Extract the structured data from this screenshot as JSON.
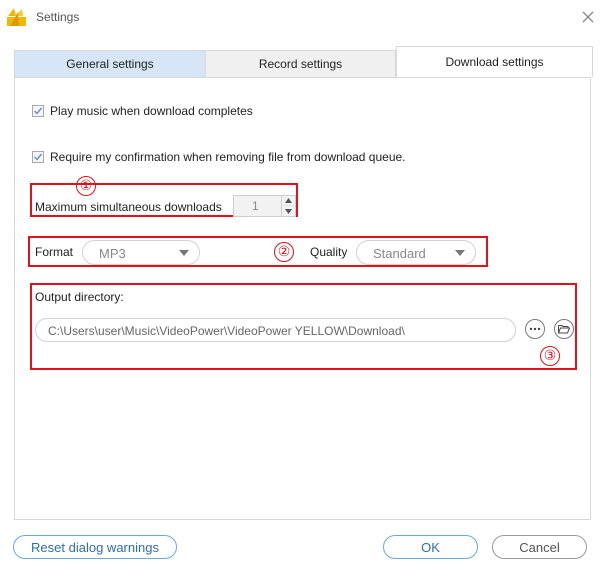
{
  "window": {
    "title": "Settings",
    "app_icon": "videopower-logo-icon",
    "close_icon": "close-icon"
  },
  "tabs": [
    {
      "label": "General settings",
      "selected": false
    },
    {
      "label": "Record settings",
      "selected": false
    },
    {
      "label": "Download settings",
      "selected": true
    }
  ],
  "download": {
    "play_music": {
      "label": "Play music when download completes",
      "checked": true
    },
    "require_confirmation": {
      "label": "Require my confirmation when removing file from download queue.",
      "checked": true
    },
    "max_downloads": {
      "label": "Maximum simultaneous downloads",
      "value": "1"
    },
    "format": {
      "label": "Format",
      "value": "MP3"
    },
    "quality": {
      "label": "Quality",
      "value": "Standard"
    },
    "output": {
      "label": "Output directory:",
      "path": "C:\\Users\\user\\Music\\VideoPower\\VideoPower YELLOW\\Download\\",
      "browse_icon": "more-dots-icon",
      "open_folder_icon": "folder-open-icon"
    }
  },
  "annotations": {
    "marker1": "①",
    "marker2": "②",
    "marker3": "③",
    "color": "#e0121b"
  },
  "footer": {
    "reset_label": "Reset dialog warnings",
    "ok_label": "OK",
    "cancel_label": "Cancel"
  }
}
